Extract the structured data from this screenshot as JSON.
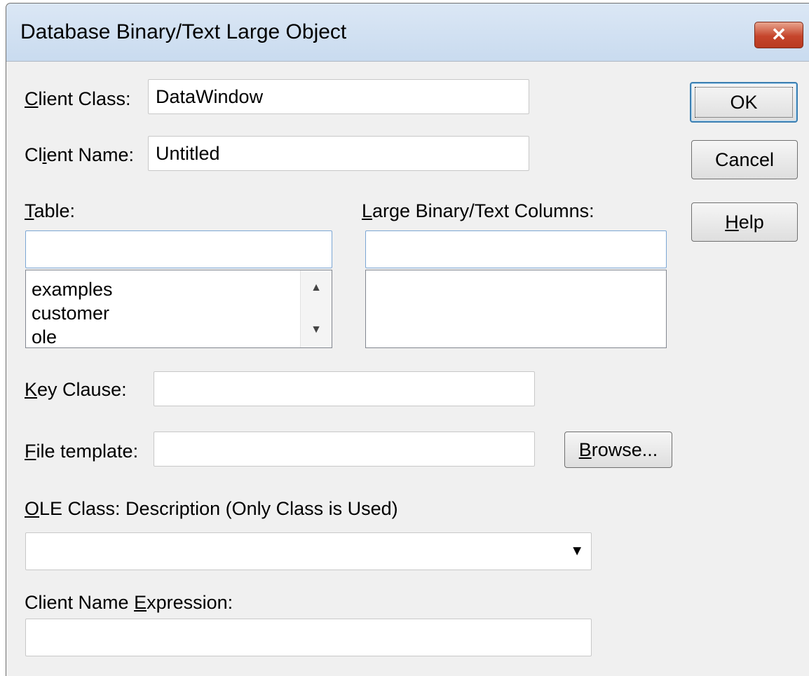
{
  "window": {
    "title": "Database Binary/Text Large Object"
  },
  "titlebar": {
    "close_icon": "close-icon",
    "close_glyph": "✕"
  },
  "form": {
    "client_class": {
      "label_u": "C",
      "label_rest": "lient Class:",
      "value": "DataWindow"
    },
    "client_name": {
      "label_a": "Cl",
      "label_u": "i",
      "label_b": "ent Name:",
      "value": "Untitled"
    },
    "table": {
      "label_u": "T",
      "label_rest": "able:",
      "filter_value": "",
      "items": [
        "examples",
        "customer",
        "ole"
      ]
    },
    "columns": {
      "label_u": "L",
      "label_rest": "arge Binary/Text Columns:",
      "filter_value": ""
    },
    "key_clause": {
      "label_u": "K",
      "label_rest": "ey Clause:",
      "value": ""
    },
    "file_template": {
      "label_u": "F",
      "label_rest": "ile template:",
      "value": ""
    },
    "browse": {
      "label_u": "B",
      "label_rest": "rowse..."
    },
    "ole_class": {
      "label_u": "O",
      "label_rest": "LE Class: Description (Only Class is Used)",
      "selected": ""
    },
    "client_name_expr": {
      "label_a": "Client Name ",
      "label_u": "E",
      "label_b": "xpression:",
      "value": ""
    }
  },
  "buttons": {
    "ok": "OK",
    "cancel": "Cancel",
    "help_u": "H",
    "help_rest": "elp"
  }
}
